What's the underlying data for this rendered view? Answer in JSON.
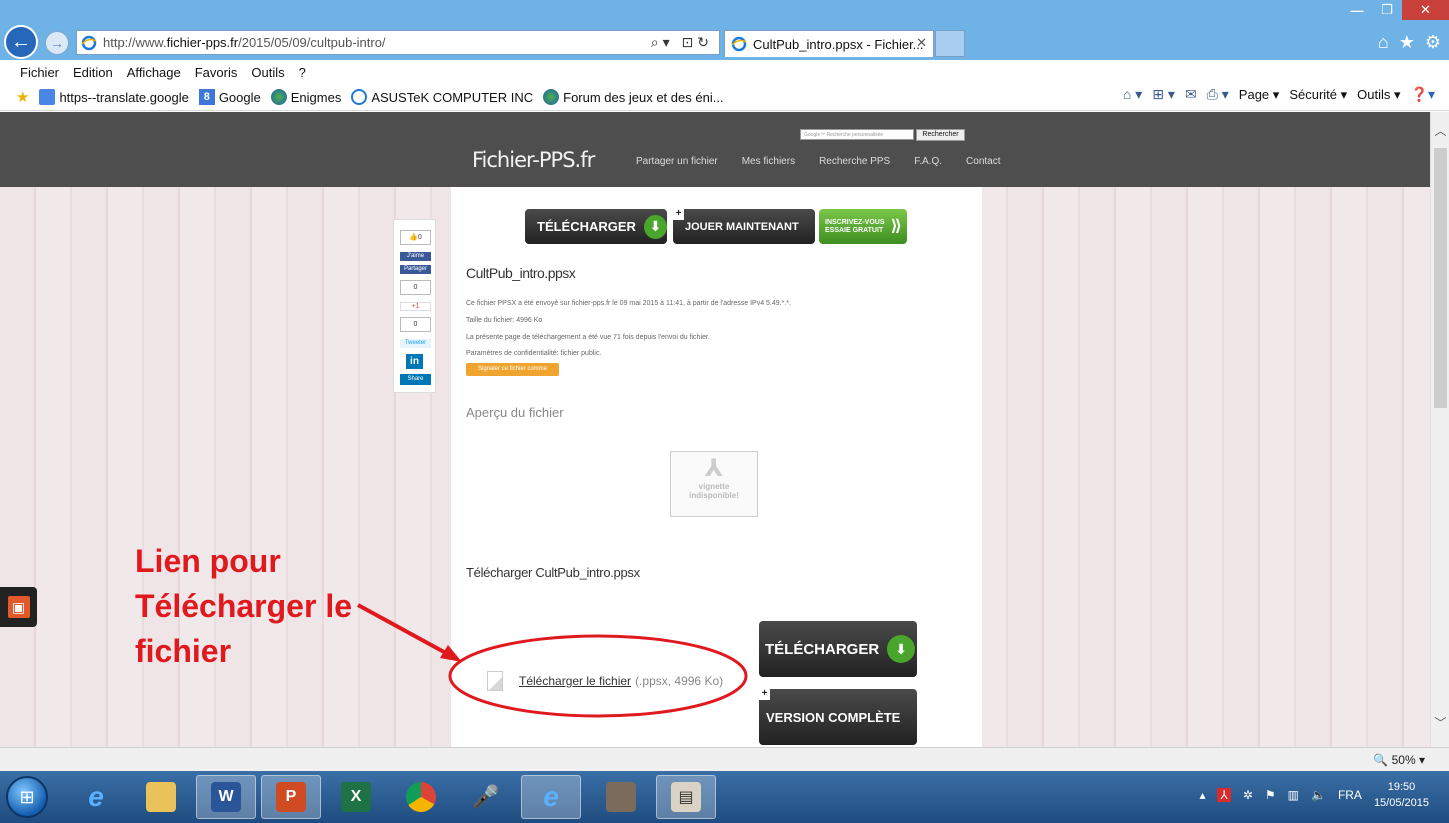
{
  "browser": {
    "address_url_prefix": "http://www.",
    "address_url_domain": "fichier-pps.fr",
    "address_url_path": "/2015/05/09/cultpub-intro/",
    "tab_title": "CultPub_intro.ppsx - Fichier...",
    "menu": [
      "Fichier",
      "Edition",
      "Affichage",
      "Favoris",
      "Outils",
      "?"
    ],
    "favorites": [
      "https--translate.google",
      "Google",
      "Enigmes",
      "ASUSTeK COMPUTER INC",
      "Forum des jeux et des éni..."
    ],
    "commands": [
      "Page",
      "Sécurité",
      "Outils"
    ],
    "zoom": "50%"
  },
  "site": {
    "logo": "Fichier-PPS.fr",
    "nav": [
      "Partager un fichier",
      "Mes fichiers",
      "Recherche PPS",
      "F.A.Q.",
      "Contact"
    ],
    "search_placeholder": "Google™ Recherche personnalisée",
    "search_button": "Rechercher"
  },
  "page": {
    "top_download": "TÉLÉCHARGER",
    "top_play": "JOUER MAINTENANT",
    "top_signup_line1": "INSCRIVEZ-VOUS",
    "top_signup_line2": "ESSAIE GRATUIT",
    "file_title": "CultPub_intro.ppsx",
    "info_1": "Ce fichier PPSX a été envoyé sur fichier-pps.fr le 09 mai 2015 à 11:41, à partir de l'adresse IPv4 5.49.*.*.",
    "info_2": "Taille du fichier: 4996 Ko",
    "info_3": "La présente page de téléchargement a été vue 71 fois depuis l'envoi du fichier.",
    "info_4": "Paramètres de confidentialité: fichier public.",
    "orange_button": "Signaler ce fichier comme dangereux",
    "preview_title": "Aperçu du fichier",
    "thumb_line1": "vignette",
    "thumb_line2": "indisponible!",
    "download_heading": "Télécharger CultPub_intro.ppsx",
    "download_link": "Télécharger le fichier",
    "download_meta": "(.ppsx, 4996 Ko)",
    "big_download": "TÉLÉCHARGER",
    "big_full": "VERSION COMPLÈTE"
  },
  "social": {
    "like_count": "0",
    "fb_like": "J'aime",
    "fb_share": "Partager",
    "gplus_count": "0",
    "gplus_label": "+1",
    "tweet_count": "0",
    "tweet_label": "Tweeter",
    "linkedin_logo": "in",
    "linkedin_share": "Share"
  },
  "annotation": {
    "line1": "Lien pour",
    "line2": "Télécharger le",
    "line3": "fichier",
    "color": "#e0191e"
  },
  "taskbar": {
    "lang": "FRA",
    "time": "19:50",
    "date": "15/05/2015"
  }
}
